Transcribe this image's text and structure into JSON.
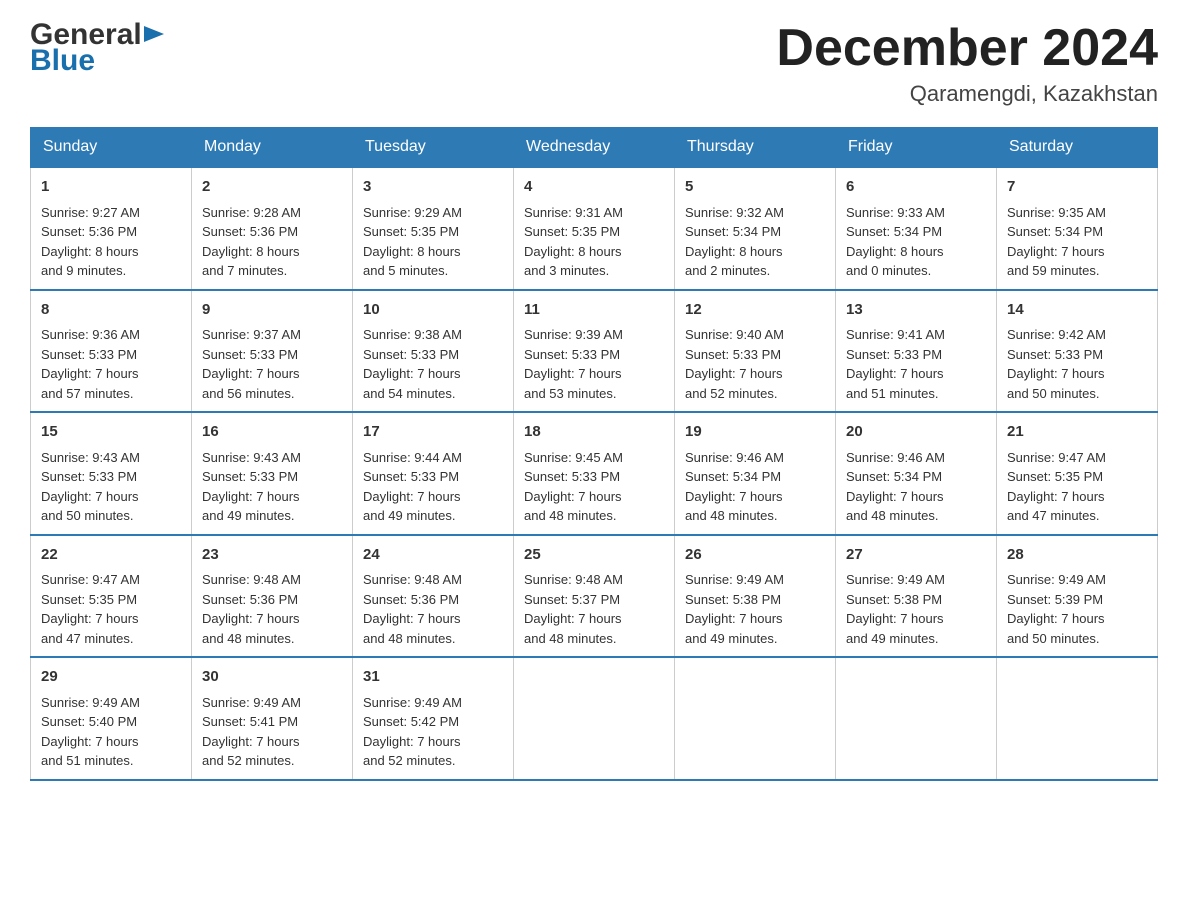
{
  "header": {
    "logo_general": "General",
    "logo_blue": "Blue",
    "month_title": "December 2024",
    "location": "Qaramengdi, Kazakhstan"
  },
  "days_of_week": [
    "Sunday",
    "Monday",
    "Tuesday",
    "Wednesday",
    "Thursday",
    "Friday",
    "Saturday"
  ],
  "weeks": [
    [
      {
        "day": "1",
        "sunrise": "9:27 AM",
        "sunset": "5:36 PM",
        "daylight": "8 hours and 9 minutes."
      },
      {
        "day": "2",
        "sunrise": "9:28 AM",
        "sunset": "5:36 PM",
        "daylight": "8 hours and 7 minutes."
      },
      {
        "day": "3",
        "sunrise": "9:29 AM",
        "sunset": "5:35 PM",
        "daylight": "8 hours and 5 minutes."
      },
      {
        "day": "4",
        "sunrise": "9:31 AM",
        "sunset": "5:35 PM",
        "daylight": "8 hours and 3 minutes."
      },
      {
        "day": "5",
        "sunrise": "9:32 AM",
        "sunset": "5:34 PM",
        "daylight": "8 hours and 2 minutes."
      },
      {
        "day": "6",
        "sunrise": "9:33 AM",
        "sunset": "5:34 PM",
        "daylight": "8 hours and 0 minutes."
      },
      {
        "day": "7",
        "sunrise": "9:35 AM",
        "sunset": "5:34 PM",
        "daylight": "7 hours and 59 minutes."
      }
    ],
    [
      {
        "day": "8",
        "sunrise": "9:36 AM",
        "sunset": "5:33 PM",
        "daylight": "7 hours and 57 minutes."
      },
      {
        "day": "9",
        "sunrise": "9:37 AM",
        "sunset": "5:33 PM",
        "daylight": "7 hours and 56 minutes."
      },
      {
        "day": "10",
        "sunrise": "9:38 AM",
        "sunset": "5:33 PM",
        "daylight": "7 hours and 54 minutes."
      },
      {
        "day": "11",
        "sunrise": "9:39 AM",
        "sunset": "5:33 PM",
        "daylight": "7 hours and 53 minutes."
      },
      {
        "day": "12",
        "sunrise": "9:40 AM",
        "sunset": "5:33 PM",
        "daylight": "7 hours and 52 minutes."
      },
      {
        "day": "13",
        "sunrise": "9:41 AM",
        "sunset": "5:33 PM",
        "daylight": "7 hours and 51 minutes."
      },
      {
        "day": "14",
        "sunrise": "9:42 AM",
        "sunset": "5:33 PM",
        "daylight": "7 hours and 50 minutes."
      }
    ],
    [
      {
        "day": "15",
        "sunrise": "9:43 AM",
        "sunset": "5:33 PM",
        "daylight": "7 hours and 50 minutes."
      },
      {
        "day": "16",
        "sunrise": "9:43 AM",
        "sunset": "5:33 PM",
        "daylight": "7 hours and 49 minutes."
      },
      {
        "day": "17",
        "sunrise": "9:44 AM",
        "sunset": "5:33 PM",
        "daylight": "7 hours and 49 minutes."
      },
      {
        "day": "18",
        "sunrise": "9:45 AM",
        "sunset": "5:33 PM",
        "daylight": "7 hours and 48 minutes."
      },
      {
        "day": "19",
        "sunrise": "9:46 AM",
        "sunset": "5:34 PM",
        "daylight": "7 hours and 48 minutes."
      },
      {
        "day": "20",
        "sunrise": "9:46 AM",
        "sunset": "5:34 PM",
        "daylight": "7 hours and 48 minutes."
      },
      {
        "day": "21",
        "sunrise": "9:47 AM",
        "sunset": "5:35 PM",
        "daylight": "7 hours and 47 minutes."
      }
    ],
    [
      {
        "day": "22",
        "sunrise": "9:47 AM",
        "sunset": "5:35 PM",
        "daylight": "7 hours and 47 minutes."
      },
      {
        "day": "23",
        "sunrise": "9:48 AM",
        "sunset": "5:36 PM",
        "daylight": "7 hours and 48 minutes."
      },
      {
        "day": "24",
        "sunrise": "9:48 AM",
        "sunset": "5:36 PM",
        "daylight": "7 hours and 48 minutes."
      },
      {
        "day": "25",
        "sunrise": "9:48 AM",
        "sunset": "5:37 PM",
        "daylight": "7 hours and 48 minutes."
      },
      {
        "day": "26",
        "sunrise": "9:49 AM",
        "sunset": "5:38 PM",
        "daylight": "7 hours and 49 minutes."
      },
      {
        "day": "27",
        "sunrise": "9:49 AM",
        "sunset": "5:38 PM",
        "daylight": "7 hours and 49 minutes."
      },
      {
        "day": "28",
        "sunrise": "9:49 AM",
        "sunset": "5:39 PM",
        "daylight": "7 hours and 50 minutes."
      }
    ],
    [
      {
        "day": "29",
        "sunrise": "9:49 AM",
        "sunset": "5:40 PM",
        "daylight": "7 hours and 51 minutes."
      },
      {
        "day": "30",
        "sunrise": "9:49 AM",
        "sunset": "5:41 PM",
        "daylight": "7 hours and 52 minutes."
      },
      {
        "day": "31",
        "sunrise": "9:49 AM",
        "sunset": "5:42 PM",
        "daylight": "7 hours and 52 minutes."
      },
      null,
      null,
      null,
      null
    ]
  ],
  "labels": {
    "sunrise": "Sunrise:",
    "sunset": "Sunset:",
    "daylight": "Daylight:"
  }
}
